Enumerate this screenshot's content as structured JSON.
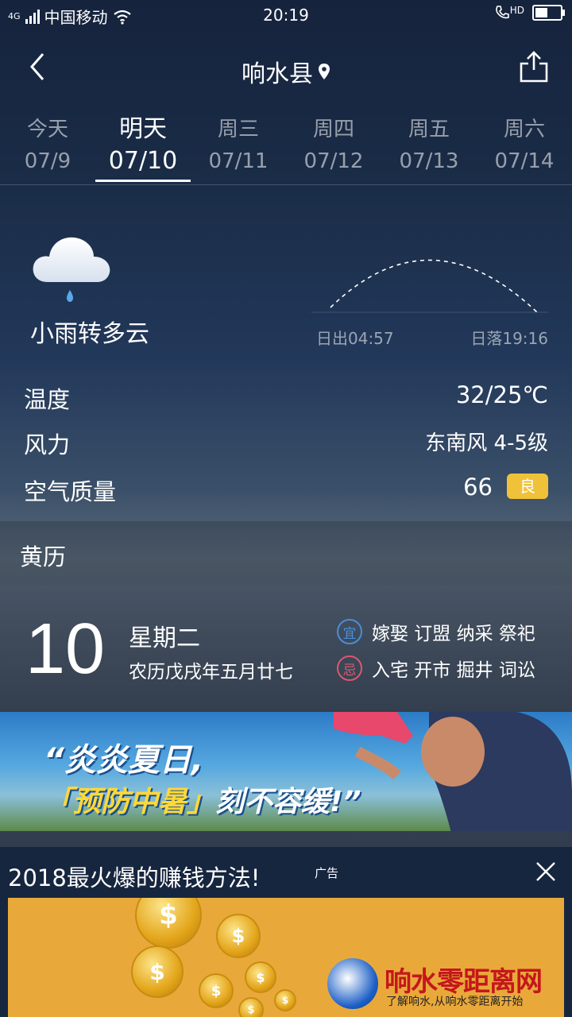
{
  "status": {
    "network_type": "4G",
    "carrier": "中国移动",
    "time": "20:19",
    "hd_label": "HD",
    "battery_level": 0.5
  },
  "header": {
    "city": "响水县"
  },
  "tabs": [
    {
      "day": "今天",
      "date": "07/9"
    },
    {
      "day": "明天",
      "date": "07/10",
      "active": true
    },
    {
      "day": "周三",
      "date": "07/11"
    },
    {
      "day": "周四",
      "date": "07/12"
    },
    {
      "day": "周五",
      "date": "07/13"
    },
    {
      "day": "周六",
      "date": "07/14"
    }
  ],
  "weather": {
    "condition": "小雨转多云",
    "icon": "cloud-rain-icon",
    "sunrise": "日出04:57",
    "sunset": "日落19:16",
    "rows": {
      "temp": {
        "label": "温度",
        "value": "32/25℃"
      },
      "wind": {
        "label": "风力",
        "value": "东南风 4-5级"
      },
      "aqi": {
        "label": "空气质量",
        "value": "66",
        "badge": "良",
        "badge_color": "#f0c23a"
      }
    }
  },
  "almanac": {
    "title": "黄历",
    "day": "10",
    "weekday": "星期二",
    "lunar": "农历戊戌年五月廿七",
    "yi_label": "宜",
    "yi": "嫁娶 订盟 纳采 祭祀",
    "ji_label": "忌",
    "ji": "入宅 开市 掘井 词讼"
  },
  "banner": {
    "line1": "“炎炎夏日,",
    "line2_a": "「预防中暑」",
    "line2_b": "刻不容缓!”"
  },
  "ad": {
    "headline": "2018最火爆的赚钱方法!",
    "tag": "广告"
  },
  "watermark": {
    "name": "响水零距离网",
    "slogan": "了解响水,从响水零距离开始"
  }
}
